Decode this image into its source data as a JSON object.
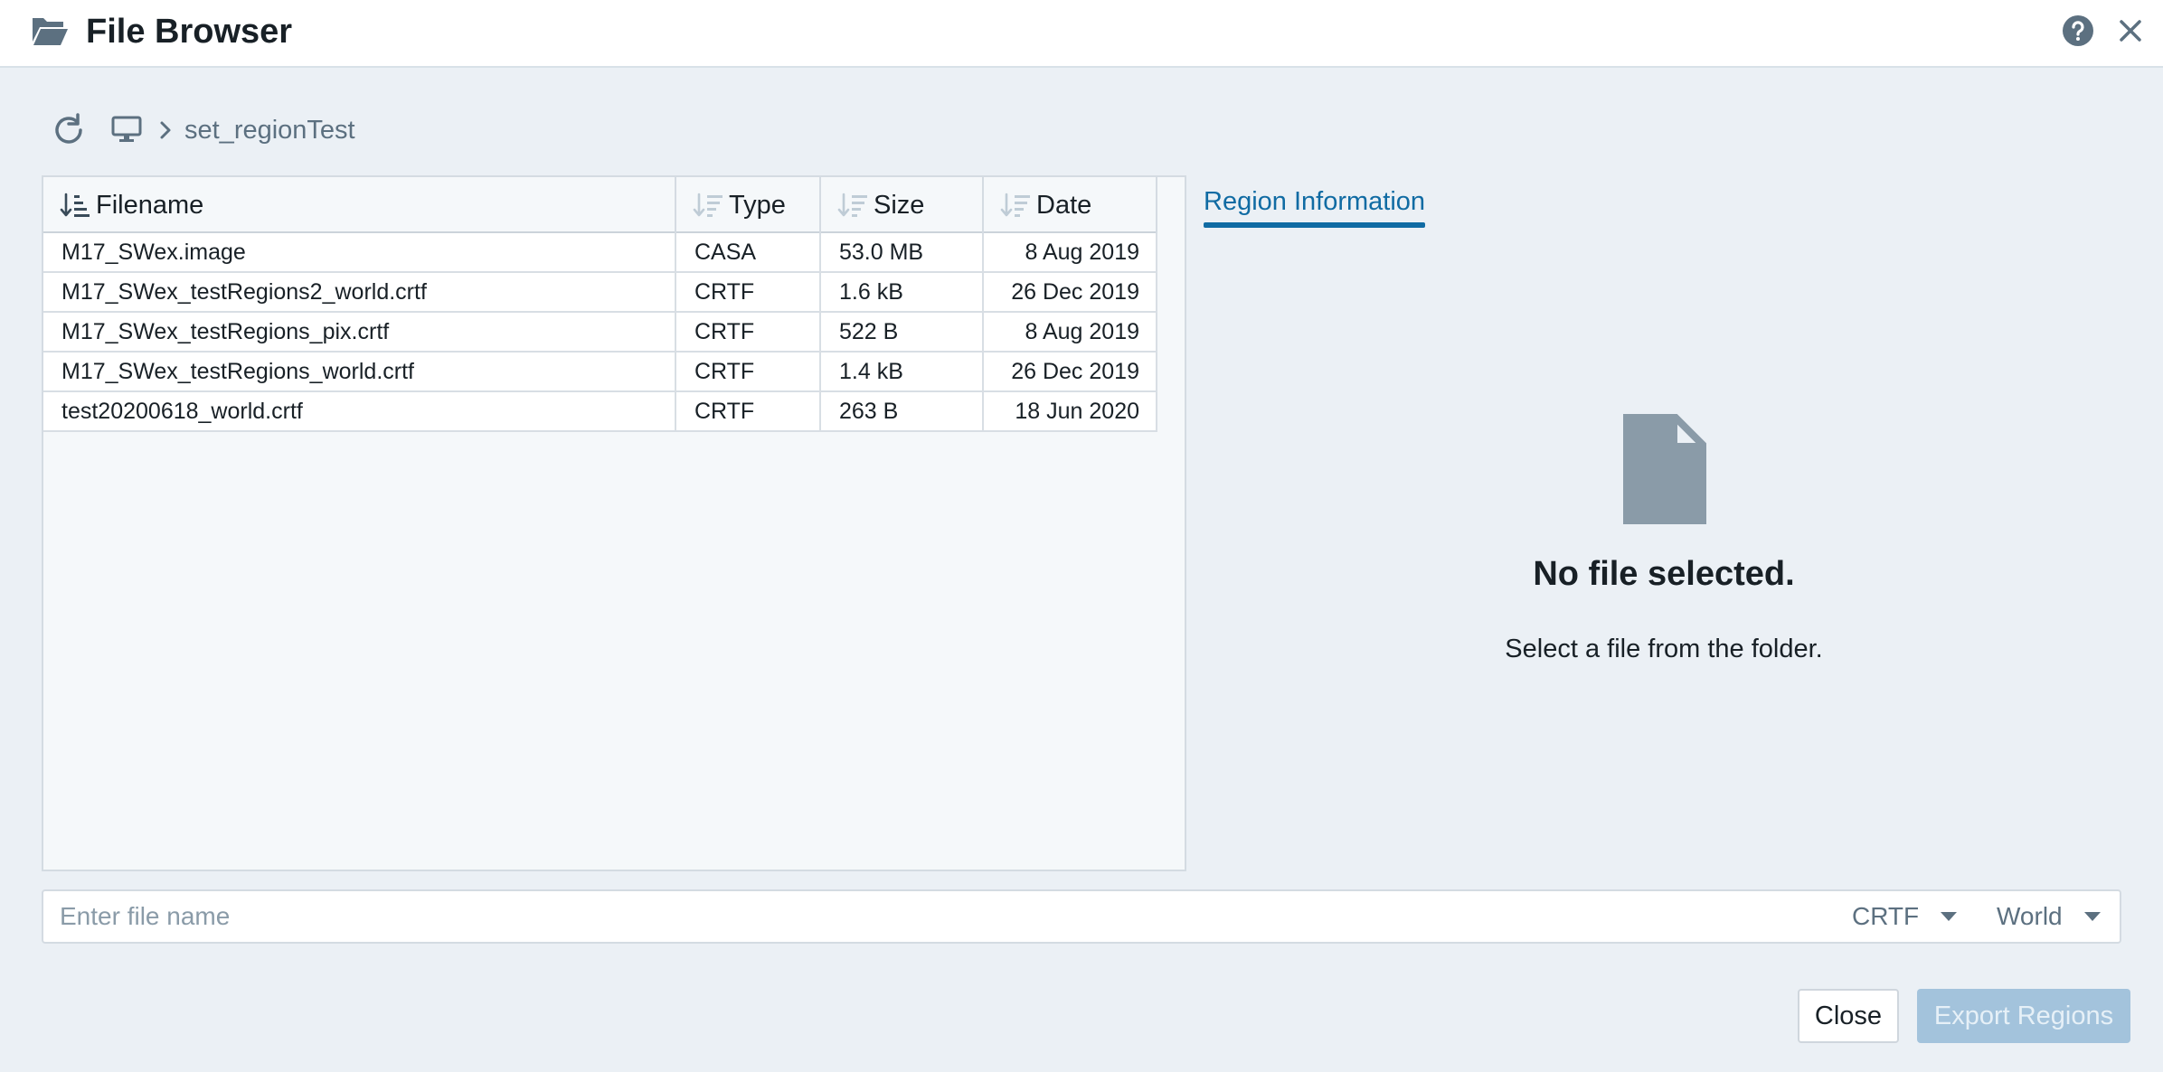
{
  "window": {
    "title": "File Browser",
    "icons": {
      "folder": "folder-open-icon",
      "help": "help-icon",
      "close": "close-icon"
    }
  },
  "breadcrumb": {
    "refresh_icon": "refresh-icon",
    "root_icon": "computer-icon",
    "separator_icon": "chevron-right-icon",
    "current_folder": "set_regionTest"
  },
  "file_table": {
    "columns": [
      {
        "label": "Filename",
        "sort": "ascending"
      },
      {
        "label": "Type",
        "sort": "none"
      },
      {
        "label": "Size",
        "sort": "none"
      },
      {
        "label": "Date",
        "sort": "none"
      }
    ],
    "rows": [
      {
        "name": "M17_SWex.image",
        "type": "CASA",
        "size": "53.0 MB",
        "date": "8 Aug 2019"
      },
      {
        "name": "M17_SWex_testRegions2_world.crtf",
        "type": "CRTF",
        "size": "1.6 kB",
        "date": "26 Dec 2019"
      },
      {
        "name": "M17_SWex_testRegions_pix.crtf",
        "type": "CRTF",
        "size": "522 B",
        "date": "8 Aug 2019"
      },
      {
        "name": "M17_SWex_testRegions_world.crtf",
        "type": "CRTF",
        "size": "1.4 kB",
        "date": "26 Dec 2019"
      },
      {
        "name": "test20200618_world.crtf",
        "type": "CRTF",
        "size": "263 B",
        "date": "18 Jun 2020"
      }
    ]
  },
  "info_panel": {
    "tab_label": "Region Information",
    "empty_icon": "document-icon",
    "empty_title": "No file selected.",
    "empty_description": "Select a file from the folder."
  },
  "export_bar": {
    "filename_value": "",
    "filename_placeholder": "Enter file name",
    "format_selected": "CRTF",
    "coordinate_selected": "World"
  },
  "buttons": {
    "close_label": "Close",
    "export_label": "Export Regions"
  },
  "colors": {
    "accent": "#106ba3",
    "background": "#ebf0f5",
    "export_disabled": "#a3c3dc"
  }
}
